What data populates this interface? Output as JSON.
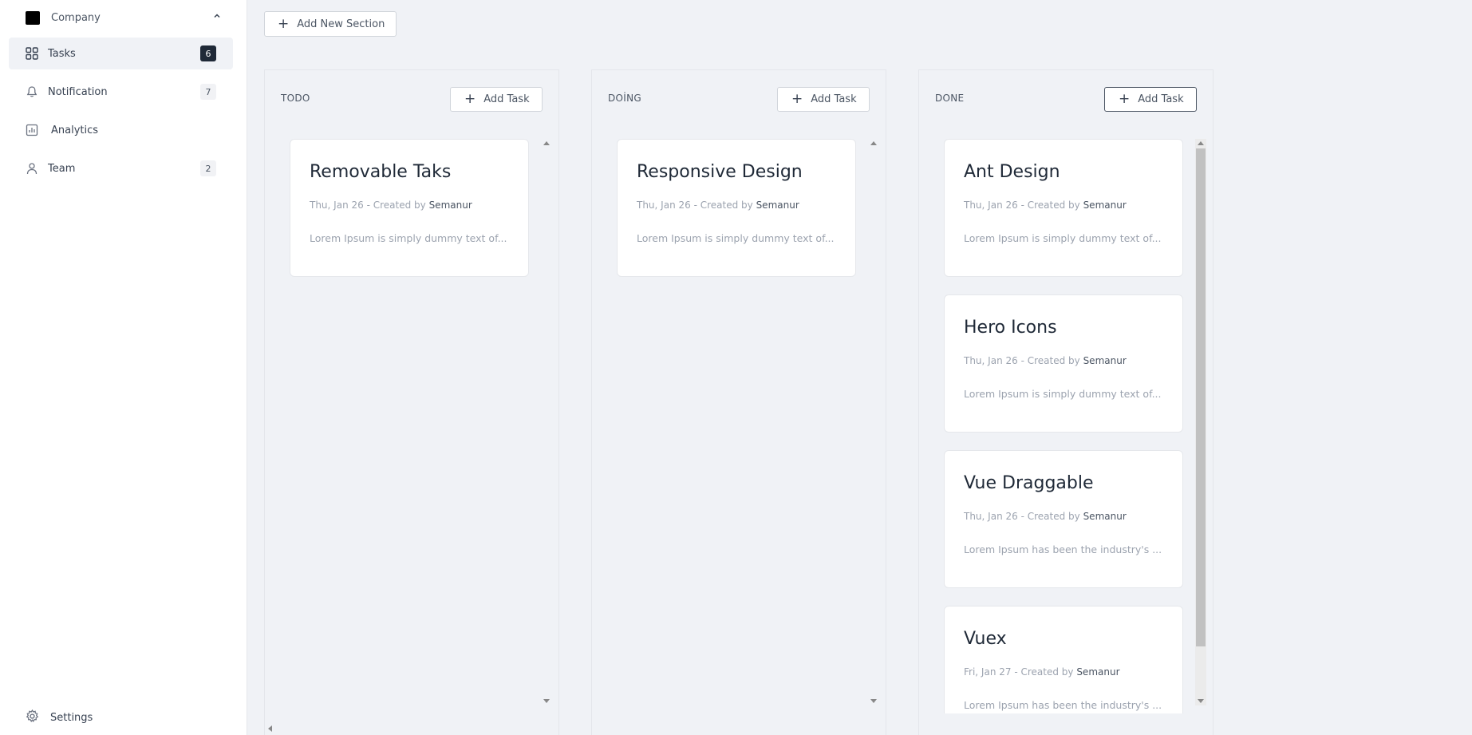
{
  "sidebar": {
    "company": {
      "name": "Company"
    },
    "items": [
      {
        "label": "Tasks",
        "icon": "grid-icon",
        "badge": "6",
        "active": true
      },
      {
        "label": "Notification",
        "icon": "bell-icon",
        "badge": "7"
      },
      {
        "label": "Analytics",
        "icon": "chart-icon",
        "badge": ""
      },
      {
        "label": "Team",
        "icon": "user-icon",
        "badge": "2"
      }
    ],
    "settings": {
      "label": "Settings",
      "icon": "gear-icon"
    }
  },
  "toolbar": {
    "add_section_label": "Add New Section"
  },
  "columns": [
    {
      "title": "TODO",
      "add_task_label": "Add Task",
      "cards": [
        {
          "title": "Removable Taks",
          "date": "Thu, Jan 26",
          "created_by_prefix": " - Created by ",
          "author": "Semanur",
          "description": "Lorem Ipsum is simply dummy text of..."
        }
      ]
    },
    {
      "title": "DOİNG",
      "add_task_label": "Add Task",
      "cards": [
        {
          "title": "Responsive Design",
          "date": "Thu, Jan 26",
          "created_by_prefix": " - Created by ",
          "author": "Semanur",
          "description": "Lorem Ipsum is simply dummy text of..."
        }
      ]
    },
    {
      "title": "DONE",
      "add_task_label": "Add Task",
      "cards": [
        {
          "title": "Ant Design",
          "date": "Thu, Jan 26",
          "created_by_prefix": " - Created by ",
          "author": "Semanur",
          "description": "Lorem Ipsum is simply dummy text of..."
        },
        {
          "title": "Hero Icons",
          "date": "Thu, Jan 26",
          "created_by_prefix": " - Created by ",
          "author": "Semanur",
          "description": "Lorem Ipsum is simply dummy text of..."
        },
        {
          "title": "Vue Draggable",
          "date": "Thu, Jan 26",
          "created_by_prefix": " - Created by ",
          "author": "Semanur",
          "description": "Lorem Ipsum has been the industry's ..."
        },
        {
          "title": "Vuex",
          "date": "Fri, Jan 27",
          "created_by_prefix": " - Created by ",
          "author": "Semanur",
          "description": "Lorem Ipsum has been the industry's ..."
        }
      ]
    }
  ],
  "colors": {
    "sidebar_bg": "#ffffff",
    "page_bg": "#f0f2f6",
    "badge_dark": "#1f2937",
    "text": "#374151",
    "muted": "#9ca3af"
  }
}
